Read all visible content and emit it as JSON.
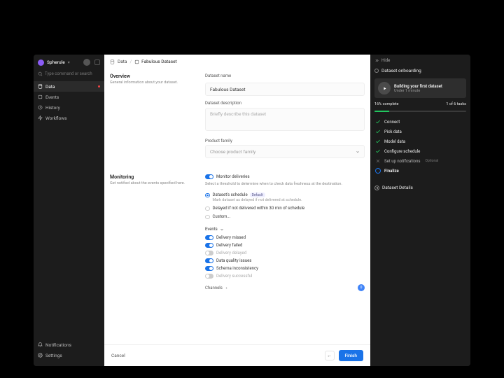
{
  "sidebar": {
    "org": "Spherule",
    "search_placeholder": "Type command or search",
    "nav": [
      {
        "label": "Data",
        "icon": "data",
        "active": true,
        "alert": true
      },
      {
        "label": "Events",
        "icon": "events"
      },
      {
        "label": "History",
        "icon": "history"
      },
      {
        "label": "Workflows",
        "icon": "workflows"
      }
    ],
    "footer": [
      {
        "label": "Notifications",
        "icon": "bell"
      },
      {
        "label": "Settings",
        "icon": "gear"
      }
    ]
  },
  "crumbs": {
    "root": "Data",
    "current": "Fabulous Dataset"
  },
  "overview": {
    "title": "Overview",
    "desc": "General information about your dataset.",
    "name_label": "Dataset name",
    "name_value": "Fabulous Dataset",
    "desc_label": "Dataset description",
    "desc_placeholder": "Briefly describe this dataset",
    "family_label": "Product family",
    "family_placeholder": "Choose product family"
  },
  "monitoring": {
    "title": "Monitoring",
    "desc": "Get notified about the events specified here.",
    "monitor_label": "Monitor deliveries",
    "monitor_on": true,
    "hint": "Select a threshold to determine when to check data freshness at the destination.",
    "radios": [
      {
        "label": "Dataset's schedule",
        "badge": "Default",
        "sub": "Mark dataset as delayed if not delivered at schedule.",
        "checked": true
      },
      {
        "label": "Delayed if not delivered within  30 min  of schedule",
        "checked": false
      },
      {
        "label": "Custom...",
        "checked": false
      }
    ],
    "events_header": "Events",
    "events": [
      {
        "label": "Delivery missed",
        "on": true
      },
      {
        "label": "Delivery failed",
        "on": true
      },
      {
        "label": "Delivery delayed",
        "on": false,
        "muted": true
      },
      {
        "label": "Data quality issues",
        "on": true
      },
      {
        "label": "Schema inconsistency",
        "on": true
      },
      {
        "label": "Delivery successful",
        "on": false,
        "muted": true
      }
    ],
    "channels_label": "Channels",
    "channel_count": "0"
  },
  "footer": {
    "cancel": "Cancel",
    "finish": "Finish"
  },
  "rpanel": {
    "hide": "Hide",
    "onboarding": "Dataset onboarding",
    "card_title": "Building your first dataset",
    "card_sub": "Under 1 minute",
    "progress_label": "16% complete",
    "tasks_count": "1 of 6 tasks",
    "progress_pct": 16,
    "steps": [
      {
        "label": "Connect",
        "state": "done"
      },
      {
        "label": "Pick data",
        "state": "done"
      },
      {
        "label": "Model data",
        "state": "done"
      },
      {
        "label": "Configure schedule",
        "state": "done"
      },
      {
        "label": "Set up notifications",
        "state": "optional",
        "tag": "Optional"
      },
      {
        "label": "Finalize",
        "state": "current"
      }
    ],
    "details": "Dataset Details"
  }
}
